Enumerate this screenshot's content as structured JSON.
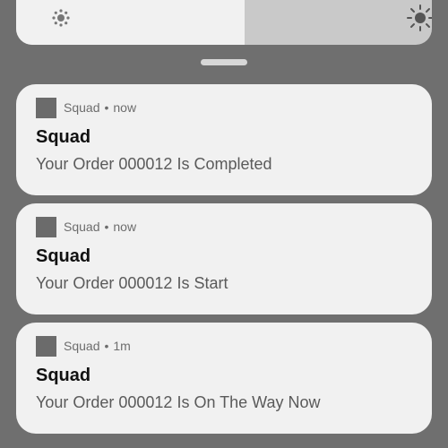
{
  "brightness": {
    "level": 0.55,
    "low_icon": "brightness-low-icon",
    "high_icon": "brightness-high-icon"
  },
  "notifications": [
    {
      "app_name": "Squad",
      "separator": "•",
      "time": "now",
      "title": "Squad",
      "message": "Your Order 000012 Is Completed"
    },
    {
      "app_name": "Squad",
      "separator": "•",
      "time": "now",
      "title": "Squad",
      "message": "Your Order 000012 Is Start"
    },
    {
      "app_name": "Squad",
      "separator": "•",
      "time": "1m",
      "title": "Squad",
      "message": "Your Order 000012 Is On The Way Now"
    }
  ],
  "colors": {
    "background": "#6f6f6f",
    "card": "#f1f1f1",
    "app_icon": "#6b6b6b"
  }
}
